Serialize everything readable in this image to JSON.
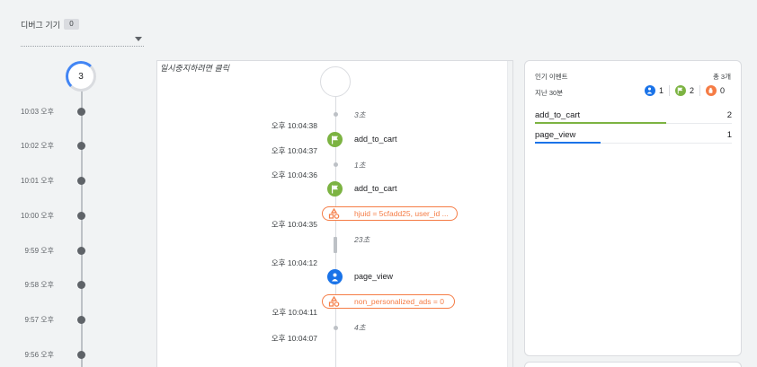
{
  "device": {
    "label": "디버그 기기",
    "count": "0"
  },
  "minutes": {
    "count": "3",
    "rows": [
      "10:03 오후",
      "10:02 오후",
      "10:01 오후",
      "10:00 오후",
      "9:59 오후",
      "9:58 오후",
      "9:57 오후",
      "9:56 오후"
    ]
  },
  "seconds": {
    "pause_hint": "일시중지하려면 클릭",
    "timestamps": [
      "오후 10:04:38",
      "오후 10:04:37",
      "오후 10:04:36",
      "오후 10:04:35",
      "오후 10:04:12",
      "오후 10:04:11",
      "오후 10:04:07"
    ],
    "gaps": [
      "3초",
      "1초",
      "23초",
      "4초"
    ],
    "events": [
      {
        "name": "add_to_cart",
        "icon": "flag-icon",
        "color": "#7cb342"
      },
      {
        "name": "add_to_cart",
        "icon": "flag-icon",
        "color": "#7cb342"
      },
      {
        "name": "page_view",
        "icon": "person-icon",
        "color": "#1a73e8"
      }
    ],
    "properties": [
      {
        "text": "hjuid = 5cfadd25, user_id ...",
        "icon": "user-property-icon",
        "color": "#f57c45"
      },
      {
        "text": "non_personalized_ads = 0",
        "icon": "user-property-icon",
        "color": "#f57c45"
      }
    ]
  },
  "top_events": {
    "title": "인기 이벤트",
    "total": "총 3개",
    "period": "지난 30분",
    "legend": [
      {
        "icon": "person-icon",
        "color": "#1a73e8",
        "count": "1"
      },
      {
        "icon": "flag-icon",
        "color": "#7cb342",
        "count": "2"
      },
      {
        "icon": "error-icon",
        "color": "#f57c45",
        "count": "0"
      }
    ],
    "rows": [
      {
        "name": "add_to_cart",
        "value": "2",
        "color": "#7cb342",
        "share": 0.667
      },
      {
        "name": "page_view",
        "value": "1",
        "color": "#1a73e8",
        "share": 0.333
      }
    ]
  }
}
